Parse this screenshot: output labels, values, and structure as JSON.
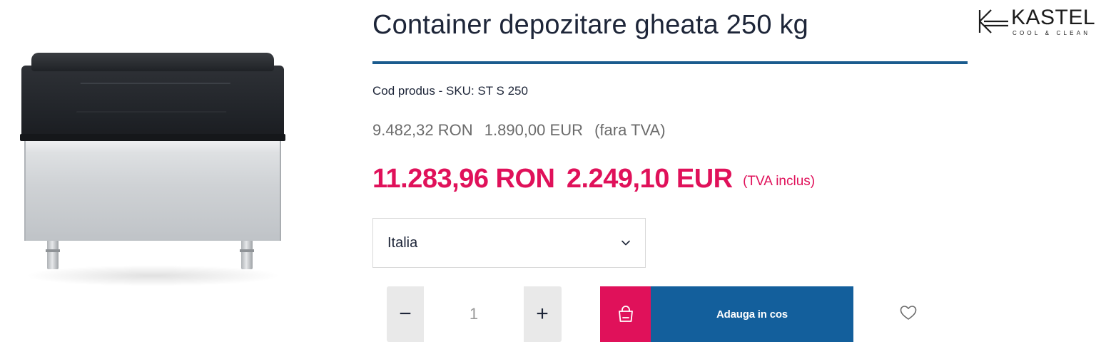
{
  "product": {
    "title": "Container depozitare gheata 250 kg",
    "image_alt": "ice-storage-bin",
    "sku_line": "Cod produs - SKU: ST S 250"
  },
  "price_net": {
    "ron": "9.482,32 RON",
    "eur": "1.890,00 EUR",
    "note": "(fara TVA)"
  },
  "price_gross": {
    "ron": "11.283,96 RON",
    "eur": "2.249,10 EUR",
    "note": "(TVA inclus)"
  },
  "origin_select": {
    "selected": "Italia",
    "icon": "chevron-down-icon"
  },
  "quantity": {
    "minus_label": "−",
    "plus_label": "+",
    "value": "1"
  },
  "cart": {
    "button_label": "Adauga in cos",
    "icon": "shopping-bag-icon"
  },
  "wishlist": {
    "icon": "heart-icon"
  },
  "brand": {
    "name": "KASTEL",
    "tagline": "COOL & CLEAN"
  },
  "colors": {
    "accent_pink": "#e0115a",
    "accent_blue": "#135f9c",
    "divider_blue": "#1a5b8e",
    "text_dark": "#1d2538",
    "text_muted": "#6b6b6b"
  }
}
